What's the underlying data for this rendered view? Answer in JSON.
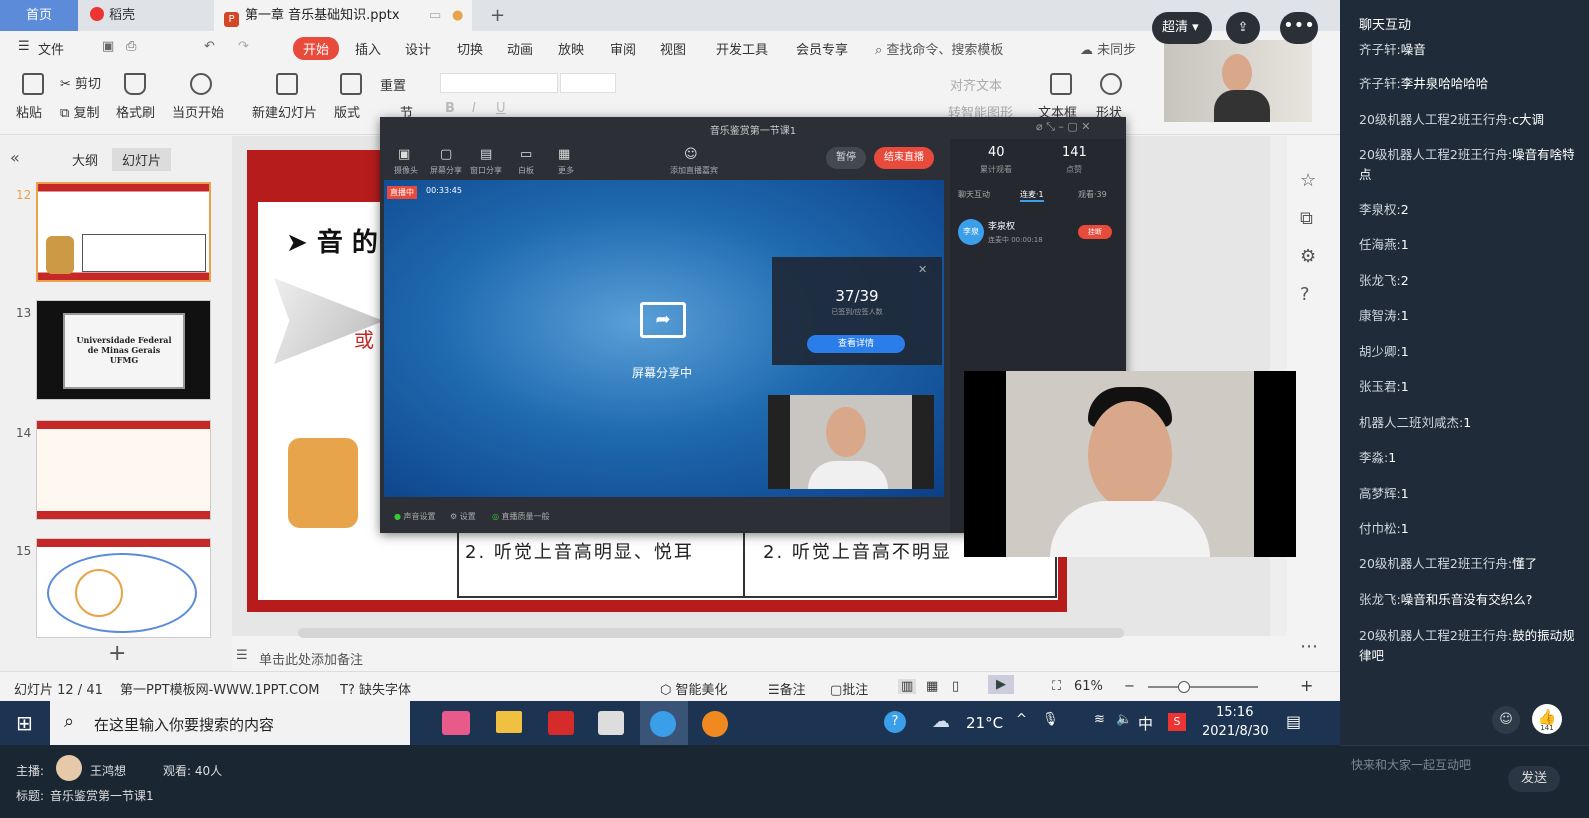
{
  "tabs": {
    "home": "首页",
    "docer": "稻壳",
    "doc": "第一章 音乐基础知识.pptx",
    "add": "+"
  },
  "menu": [
    "文件",
    "开始",
    "插入",
    "设计",
    "切换",
    "动画",
    "放映",
    "审阅",
    "视图",
    "开发工具",
    "会员专享"
  ],
  "menu_search": "查找命令、搜索模板",
  "menu_sync": "未同步",
  "ribbon": {
    "paste": "粘贴",
    "cut": "剪切",
    "copy": "复制",
    "format_painter": "格式刷",
    "from_current": "当页开始",
    "new_slide": "新建幻灯片",
    "layout": "版式",
    "reset": "重置",
    "section": "节",
    "text_direction": "对齐文本",
    "smart_shape": "转智能图形",
    "textbox": "文本框",
    "shape": "形状"
  },
  "slidepanel": {
    "outline": "大纲",
    "slides": "幻灯片",
    "nums": [
      "12",
      "13",
      "14",
      "15"
    ],
    "ufmg": "Universidade Federal de Minas Gerais UFMG"
  },
  "slide": {
    "title": "音 的",
    "fragment": "或",
    "row_left": "2. 听觉上音高明显、悦耳",
    "row_right": "2. 听觉上音高不明显"
  },
  "live": {
    "title": "音乐鉴赏第一节课1",
    "tools": [
      "摄像头",
      "屏幕分享",
      "窗口分享",
      "白板",
      "更多"
    ],
    "add_guest": "添加直播嘉宾",
    "pause": "暂停",
    "end": "结束直播",
    "live_badge": "直播中",
    "time": "00:33:45",
    "sharing": "屏幕分享中",
    "checkin": "37/39",
    "checkin_sub": "已签到/应签人数",
    "view_detail": "查看详情",
    "stat1": "40",
    "stat1_label": "累计观看",
    "stat2": "141",
    "stat2_label": "点赞",
    "ptabs": [
      "聊天互动",
      "连麦·1",
      "观看·39"
    ],
    "guest_name": "李泉权",
    "guest_status": "连麦中 00:00:18",
    "guest_avatar": "李泉",
    "hangup": "挂断",
    "bottom": [
      "声音设置",
      "设置",
      "直播质量一般"
    ]
  },
  "notes": "单击此处添加备注",
  "status": {
    "slide": "幻灯片 12 / 41",
    "template": "第一PPT模板网-WWW.1PPT.COM",
    "missing_font": "缺失字体",
    "beautify": "智能美化",
    "notes": "备注",
    "comment": "批注",
    "zoom": "61%"
  },
  "taskbar": {
    "search": "在这里输入你要搜索的内容",
    "weather": "21°C",
    "lang": "中",
    "time": "15:16",
    "date": "2021/8/30"
  },
  "bottom": {
    "host_label": "主播:",
    "host": "王鸿想",
    "viewers": "观看: 40人",
    "title_label": "标题:",
    "title": "音乐鉴赏第一节课1"
  },
  "video": {
    "quality": "超清"
  },
  "chat": {
    "header": "聊天互动",
    "messages": [
      {
        "u": "齐子轩:",
        "t": "噪音"
      },
      {
        "u": "齐子轩:",
        "t": "李井泉哈哈哈哈"
      },
      {
        "u": "20级机器人工程2班王行舟:",
        "t": "c大调"
      },
      {
        "u": "20级机器人工程2班王行舟:",
        "t": "噪音有啥特点"
      },
      {
        "u": "李泉权:",
        "t": "2"
      },
      {
        "u": "任海燕:",
        "t": "1"
      },
      {
        "u": "张龙飞:",
        "t": "2"
      },
      {
        "u": "康智涛:",
        "t": "1"
      },
      {
        "u": "胡少卿:",
        "t": "1"
      },
      {
        "u": "张玉君:",
        "t": "1"
      },
      {
        "u": "机器人二班刘咸杰:",
        "t": "1"
      },
      {
        "u": "李淼:",
        "t": "1"
      },
      {
        "u": "高梦辉:",
        "t": "1"
      },
      {
        "u": "付巾松:",
        "t": "1"
      },
      {
        "u": "20级机器人工程2班王行舟:",
        "t": "懂了"
      },
      {
        "u": "张龙飞:",
        "t": "噪音和乐音没有交织么?"
      },
      {
        "u": "20级机器人工程2班王行舟:",
        "t": "鼓的振动规律吧"
      }
    ],
    "like_count": "141",
    "input_placeholder": "快来和大家一起互动吧",
    "send": "发送"
  },
  "colors": {
    "accent": "#e84a3c",
    "chat_bg": "#1f2b38",
    "taskbar": "#1d3352"
  }
}
